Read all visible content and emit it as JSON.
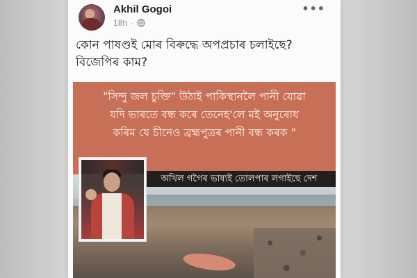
{
  "post": {
    "author": "Akhil Gogoi",
    "time": "18h",
    "privacy_icon": "globe-icon",
    "more_icon": "more-options-icon",
    "caption_lines": [
      "কোন পাষণ্ডই মোৰ বিৰুদ্ধে অপপ্ৰচাৰ চলাইছে?",
      "বিজেপিৰ কাম?"
    ]
  },
  "image": {
    "quote_lines": [
      "\"সিন্দু জল চুক্তি\" উঠাই পাকিস্থানলৈ পানী যোৱা",
      "যদি ভাৰতে বন্ধ কৰে তেনেহ'লে মই অনুৰোধ",
      "কৰিম যে চীনেও ব্ৰহ্মপুত্ৰৰ পানী বন্ধ কৰক \""
    ],
    "subtitle": "অখিল গগৈৰ ভাষ্যই তোলপাৰ লগাইছে দেশ",
    "banner_color": "#c86f58",
    "subtitle_bg": "#241f1d"
  }
}
